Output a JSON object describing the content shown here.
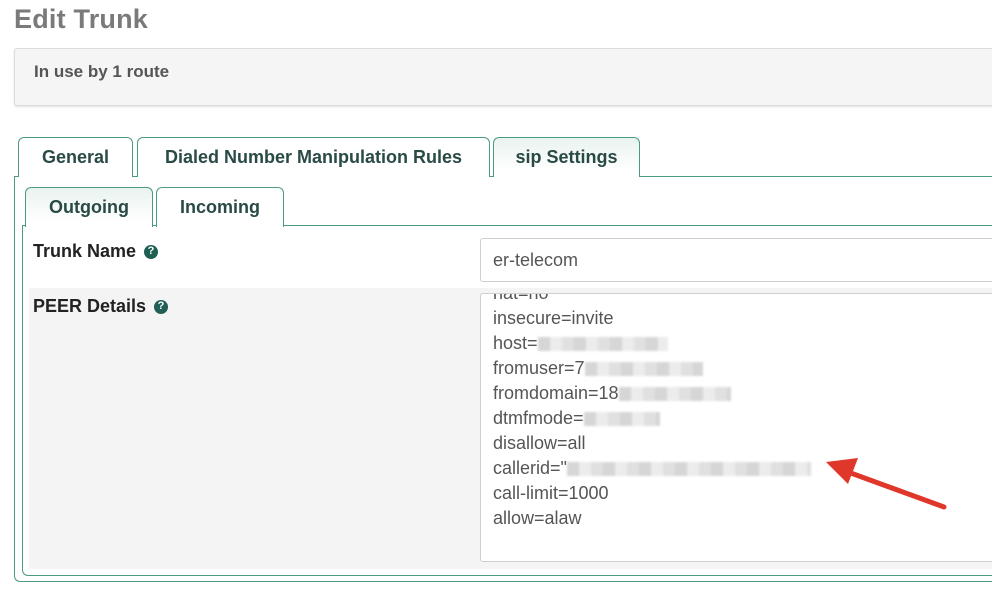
{
  "page": {
    "title": "Edit Trunk"
  },
  "info": {
    "text": "In use by 1 route"
  },
  "tabs": [
    {
      "label": "General"
    },
    {
      "label": "Dialed Number Manipulation Rules"
    },
    {
      "label": "sip Settings",
      "active": true
    }
  ],
  "subtabs": [
    {
      "label": "Outgoing",
      "active": true
    },
    {
      "label": "Incoming"
    }
  ],
  "fields": {
    "trunk_name": {
      "label": "Trunk Name",
      "value": "er-telecom"
    },
    "peer_details": {
      "label": "PEER Details",
      "lines": [
        "nat=no",
        "insecure=invite",
        "host=",
        "fromuser=7",
        "fromdomain=18",
        "dtmfmode=",
        "disallow=all",
        "callerid=\"",
        "call-limit=1000",
        "allow=alaw"
      ]
    }
  },
  "colors": {
    "accent": "#4c9a84",
    "annotation_arrow": "#e0372b"
  }
}
